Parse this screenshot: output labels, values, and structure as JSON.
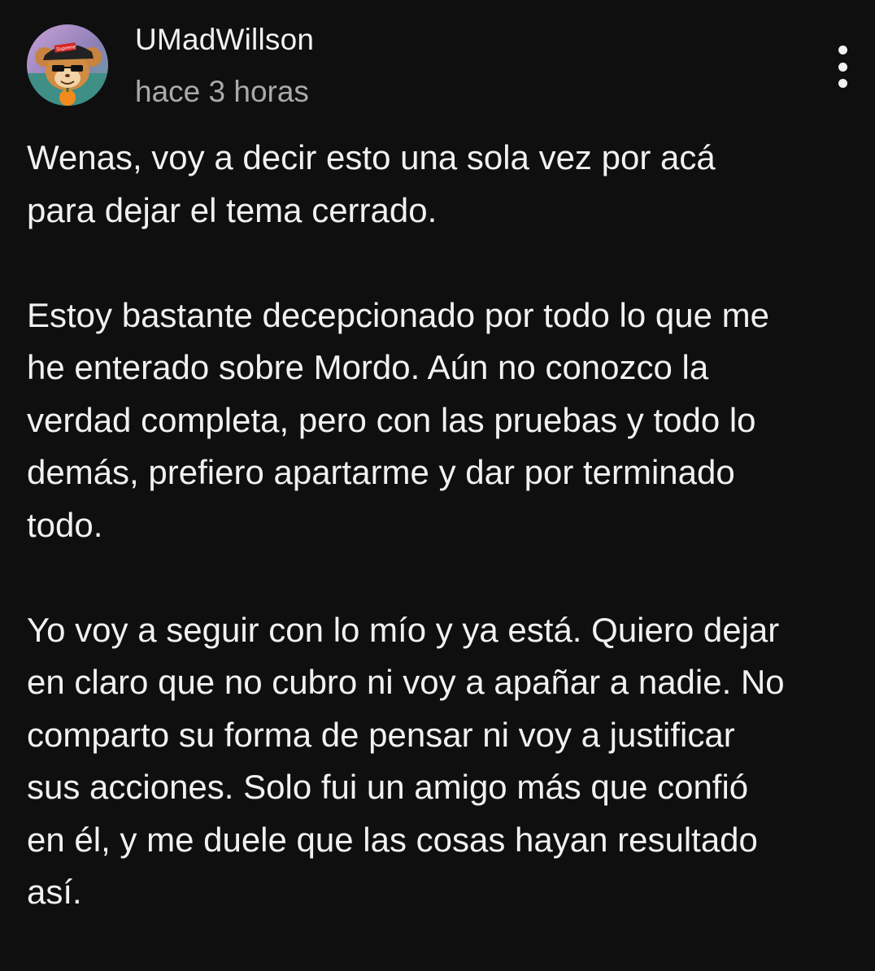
{
  "comment": {
    "author": "UMadWillson",
    "timestamp": "hace 3 horas",
    "avatar_icon": "cartoon-mouse-avatar-icon",
    "menu_icon": "more-vertical-icon",
    "avatar_cap_text": "Supreme",
    "paragraphs": [
      "Wenas, voy a decir esto una sola vez por acá\npara dejar el tema cerrado.",
      "Estoy bastante decepcionado por todo lo que me\nhe enterado sobre Mordo. Aún no conozco la\nverdad completa, pero con las pruebas y todo lo\ndemás, prefiero apartarme y dar por terminado\ntodo.",
      "Yo voy a seguir con lo mío y ya está. Quiero dejar\nen claro que no cubro ni voy a apañar a nadie. No\ncomparto su forma de pensar ni voy a justificar\nsus acciones. Solo fui un amigo más que confió\nen él, y me duele que las cosas hayan resultado\nasí."
    ]
  },
  "colors": {
    "background": "#0f0f0f",
    "text": "#f1f1f1",
    "muted": "#aaaaaa"
  }
}
